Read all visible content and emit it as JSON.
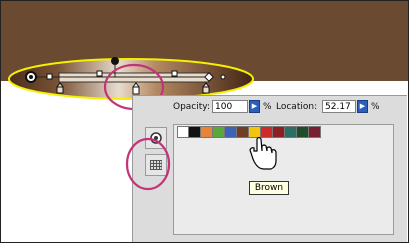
{
  "gradient_options": {
    "opacity_label": "Opacity:",
    "opacity_value": "100",
    "opacity_unit": "%",
    "location_label": "Location:",
    "location_value": "52.17",
    "location_unit": "%"
  },
  "swatches": [
    {
      "name": "white",
      "color": "#ffffff"
    },
    {
      "name": "black",
      "color": "#111111"
    },
    {
      "name": "orange",
      "color": "#e8833a"
    },
    {
      "name": "green",
      "color": "#5aa83c"
    },
    {
      "name": "blue",
      "color": "#3e62b8"
    },
    {
      "name": "brown",
      "color": "#6e3f25"
    },
    {
      "name": "yellow",
      "color": "#f2c40f"
    },
    {
      "name": "red",
      "color": "#cf2a2a"
    },
    {
      "name": "dark-red",
      "color": "#8c1f1f"
    },
    {
      "name": "teal",
      "color": "#2a6e66"
    },
    {
      "name": "dark-green",
      "color": "#1f4d2c"
    },
    {
      "name": "maroon",
      "color": "#7a1f32"
    }
  ],
  "tooltip": {
    "text": "Brown"
  },
  "colors": {
    "highlight_circle": "#c2337a",
    "gradient_outline": "#f5f000",
    "background_brown": "#6b4a32"
  }
}
